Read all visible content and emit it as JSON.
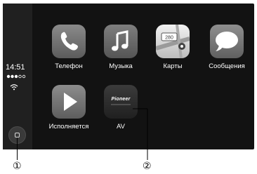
{
  "status": {
    "time": "14:51"
  },
  "apps": [
    {
      "label": "Телефон",
      "icon": "phone-icon"
    },
    {
      "label": "Музыка",
      "icon": "music-note-icon"
    },
    {
      "label": "Карты",
      "icon": "maps-icon",
      "badge": "280"
    },
    {
      "label": "Сообщения",
      "icon": "speech-bubble-icon"
    },
    {
      "label": "Исполняется",
      "icon": "play-icon"
    },
    {
      "label": "AV",
      "icon": "pioneer-logo-icon",
      "logo_text": "Pioneer"
    }
  ],
  "callouts": {
    "one": "①",
    "two": "②"
  },
  "colors": {
    "screen": "#121212",
    "sidebar": "#202020",
    "text": "#ffffff"
  }
}
